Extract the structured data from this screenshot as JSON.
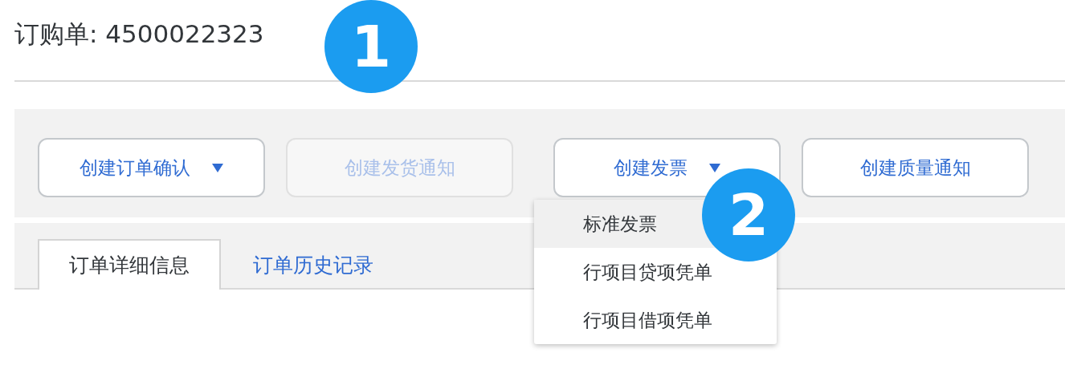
{
  "title": "订购单: 4500022323",
  "buttons": [
    {
      "label": "创建订单确认",
      "kind": "dropdown",
      "disabled": false
    },
    {
      "label": "创建发货通知",
      "kind": "plain",
      "disabled": true
    },
    {
      "label": "创建发票",
      "kind": "dropdown",
      "disabled": false,
      "expanded": true,
      "menu": [
        {
          "label": "标准发票",
          "highlighted": true
        },
        {
          "label": "行项目贷项凭单",
          "highlighted": false
        },
        {
          "label": "行项目借项凭单",
          "highlighted": false
        }
      ]
    },
    {
      "label": "创建质量通知",
      "kind": "plain",
      "disabled": false
    }
  ],
  "tabs": [
    {
      "label": "订单详细信息",
      "selected": true
    },
    {
      "label": "订单历史记录",
      "selected": false
    }
  ],
  "callouts": [
    "1",
    "2"
  ]
}
